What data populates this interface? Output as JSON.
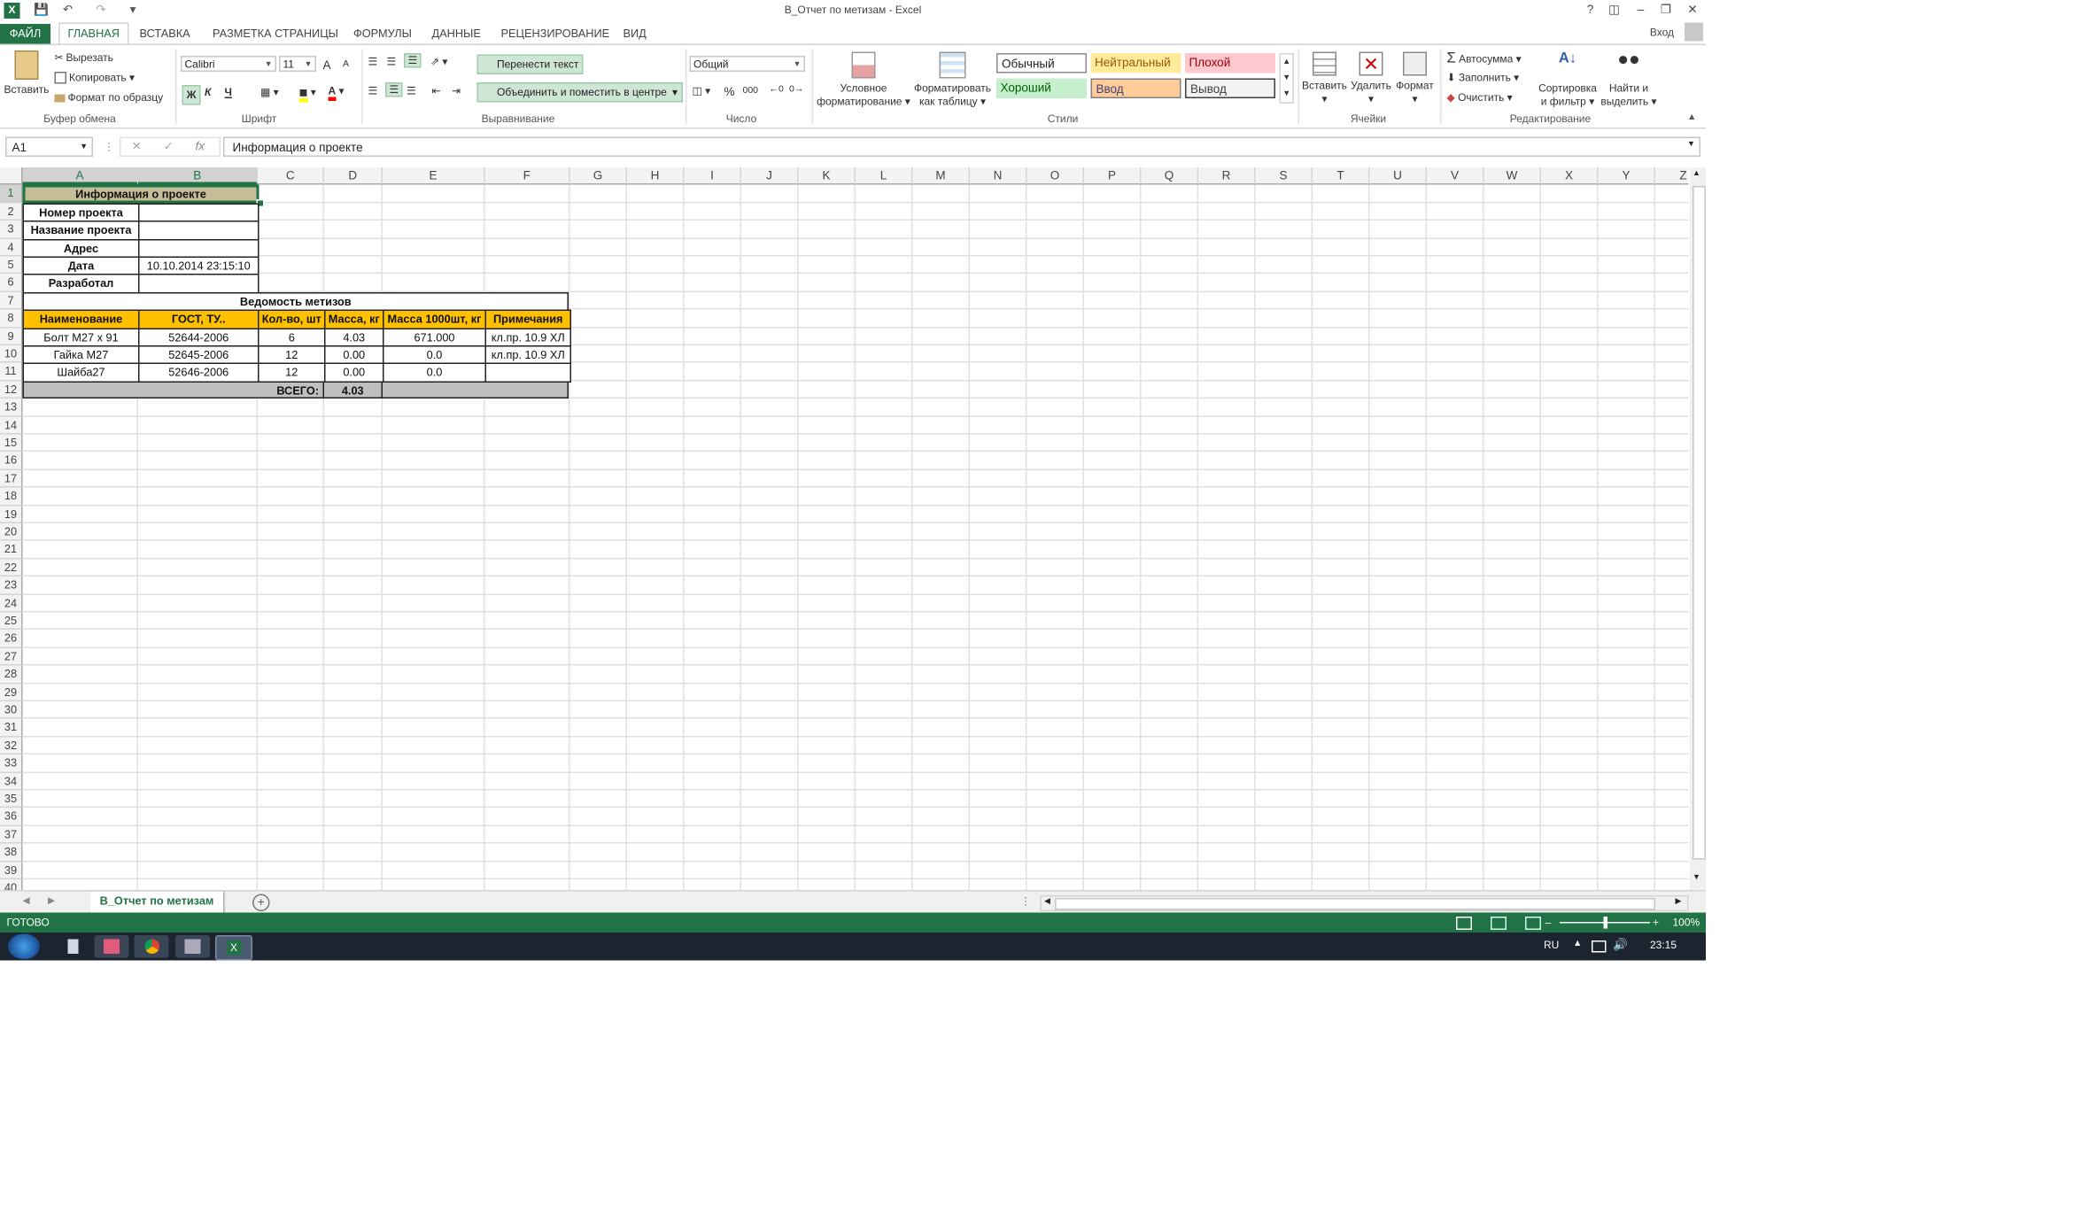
{
  "window": {
    "title": "B_Отчет по метизам - Excel",
    "signin": "Вход"
  },
  "tabs": [
    "ФАЙЛ",
    "ГЛАВНАЯ",
    "ВСТАВКА",
    "РАЗМЕТКА СТРАНИЦЫ",
    "ФОРМУЛЫ",
    "ДАННЫЕ",
    "РЕЦЕНЗИРОВАНИЕ",
    "ВИД"
  ],
  "ribbon": {
    "clipboard": {
      "paste": "Вставить",
      "cut": "Вырезать",
      "copy": "Копировать",
      "format_painter": "Формат по образцу",
      "label": "Буфер обмена"
    },
    "font": {
      "name": "Calibri",
      "size": "11",
      "bold": "Ж",
      "italic": "К",
      "underline": "Ч",
      "grow": "A",
      "shrink": "A",
      "label": "Шрифт"
    },
    "alignment": {
      "wrap": "Перенести текст",
      "merge": "Объединить и поместить в центре",
      "label": "Выравнивание"
    },
    "number": {
      "format": "Общий",
      "percent": "%",
      "thousands": "000",
      "label": "Число"
    },
    "styles": {
      "conditional": [
        "Условное",
        "форматирование"
      ],
      "as_table": [
        "Форматировать",
        "как таблицу"
      ],
      "normal": "Обычный",
      "neutral": "Нейтральный",
      "bad": "Плохой",
      "good": "Хороший",
      "input": "Ввод",
      "output": "Вывод",
      "label": "Стили"
    },
    "cells": {
      "insert": "Вставить",
      "delete": "Удалить",
      "format": "Формат",
      "label": "Ячейки"
    },
    "editing": {
      "autosum": "Автосумма",
      "fill": "Заполнить",
      "clear": "Очистить",
      "sort": [
        "Сортировка",
        "и фильтр"
      ],
      "find": [
        "Найти и",
        "выделить"
      ],
      "label": "Редактирование"
    }
  },
  "formula_bar": {
    "cell_ref": "A1",
    "fx": "fx",
    "content": "Информация о проекте"
  },
  "columns": [
    "A",
    "B",
    "C",
    "D",
    "E",
    "F",
    "G",
    "H",
    "I",
    "J",
    "K",
    "L",
    "M",
    "N",
    "O",
    "P",
    "Q",
    "R",
    "S",
    "T",
    "U",
    "V",
    "W",
    "X",
    "Y",
    "Z"
  ],
  "rows": [
    "1",
    "2",
    "3",
    "4",
    "5",
    "6",
    "7",
    "8",
    "9",
    "10",
    "11",
    "12",
    "13",
    "14",
    "15",
    "16",
    "17",
    "18",
    "19",
    "20",
    "21",
    "22",
    "23",
    "24",
    "25",
    "26",
    "27",
    "28",
    "29",
    "30",
    "31",
    "32",
    "33",
    "34",
    "35",
    "36",
    "37",
    "38",
    "39",
    "40"
  ],
  "sheet": {
    "info_title": "Информация о проекте",
    "info_rows": [
      {
        "label": "Номер проекта",
        "value": ""
      },
      {
        "label": "Название проекта",
        "value": ""
      },
      {
        "label": "Адрес",
        "value": ""
      },
      {
        "label": "Дата",
        "value": "10.10.2014  23:15:10"
      },
      {
        "label": "Разработал",
        "value": ""
      }
    ],
    "table_title": "Ведомость метизов",
    "headers": [
      "Наименование",
      "ГОСТ, ТУ..",
      "Кол-во, шт",
      "Масса, кг",
      "Масса 1000шт, кг",
      "Примечания"
    ],
    "items": [
      [
        "Болт М27 х 91",
        "52644-2006",
        "6",
        "4.03",
        "671.000",
        "кл.пр. 10.9 ХЛ"
      ],
      [
        "Гайка М27",
        "52645-2006",
        "12",
        "0.00",
        "0.0",
        "кл.пр. 10.9 ХЛ"
      ],
      [
        "Шайба27",
        "52646-2006",
        "12",
        "0.00",
        "0.0",
        ""
      ]
    ],
    "total_label": "ВСЕГО:",
    "total_value": "4.03"
  },
  "sheet_tab": "B_Отчет по метизам",
  "status": {
    "ready": "ГОТОВО",
    "zoom": "100%"
  },
  "taskbar": {
    "lang": "RU",
    "time": "23:15"
  },
  "colors": {
    "excel_green": "#217346",
    "info_fill": "#c4bd97",
    "header_fill": "#ffc000",
    "total_fill": "#bfbfbf"
  }
}
